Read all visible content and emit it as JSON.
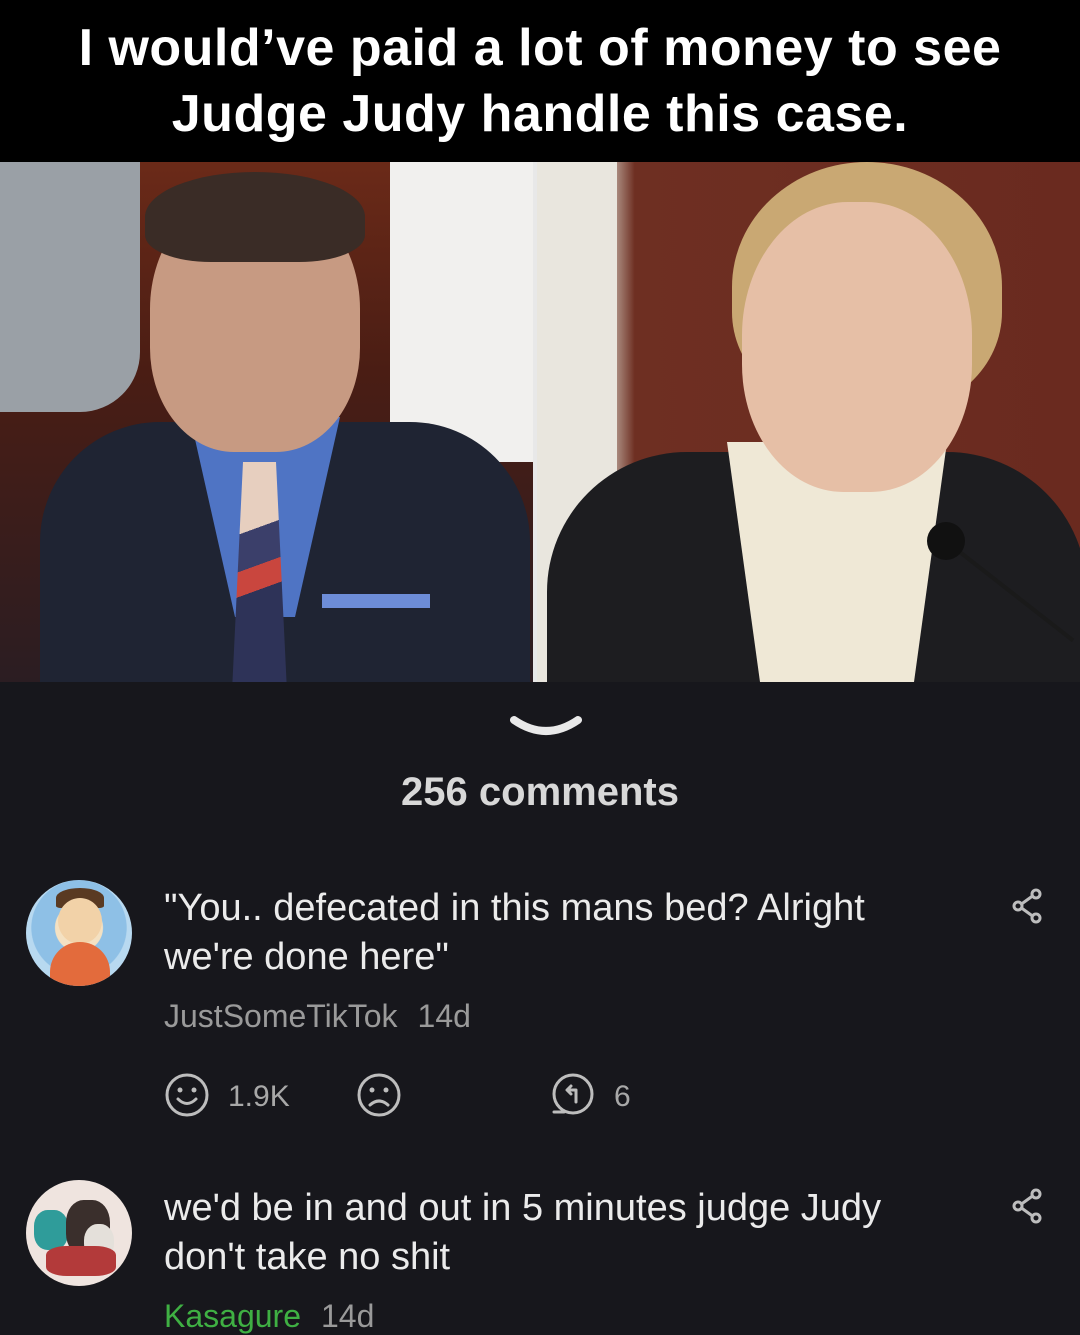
{
  "meme": {
    "caption": "I would’ve paid a lot of money to see Judge Judy handle this case."
  },
  "comments_header": {
    "count_label": "256 comments"
  },
  "comments": [
    {
      "text": "\"You.. defecated in this mans bed? Alright we're done here\"",
      "author": "JustSomeTikTok",
      "age": "14d",
      "upvotes": "1.9K",
      "replies": "6"
    },
    {
      "text": "we'd be in and out in 5 minutes judge Judy don't take no shit",
      "author": "Kasagure",
      "age": "14d"
    }
  ],
  "colors": {
    "background": "#17171c",
    "author_highlight": "#3fb043",
    "meta_text": "#9a9a9a"
  },
  "icons": {
    "collapse": "chevron-down-icon",
    "share": "share-icon",
    "upvote": "smile-icon",
    "downvote": "frown-icon",
    "reply": "reply-icon"
  }
}
